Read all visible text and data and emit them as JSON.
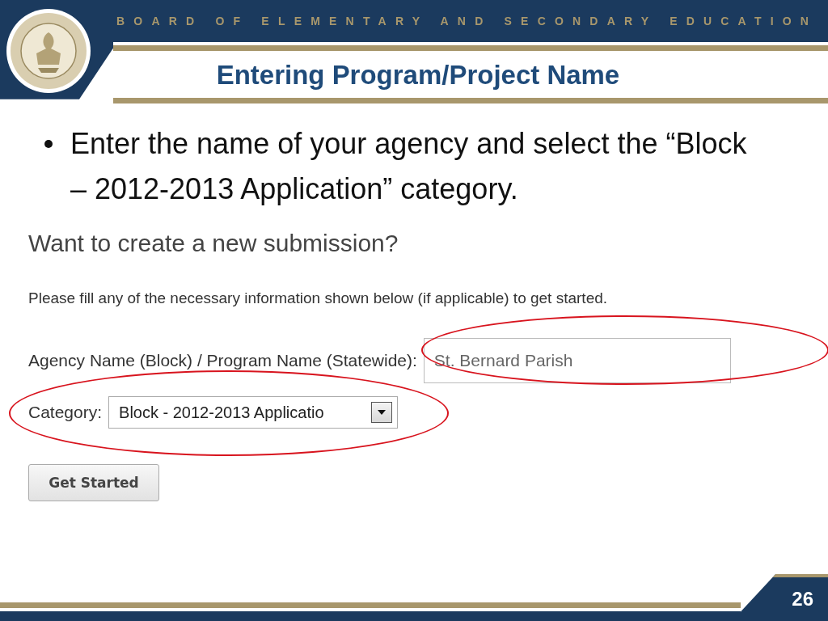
{
  "header": {
    "organization": "BOARD OF ELEMENTARY AND SECONDARY EDUCATION",
    "title": "Entering Program/Project Name"
  },
  "bullets": [
    "Enter the name of your agency and select the “Block – 2012-2013 Application” category."
  ],
  "form": {
    "heading": "Want to create a new submission?",
    "instructions": "Please fill any of the necessary information shown below (if applicable) to get started.",
    "fields": [
      {
        "kind": "text",
        "label": "Agency Name (Block) / Program Name (Statewide):",
        "value": "St. Bernard Parish",
        "highlighted": true
      },
      {
        "kind": "select",
        "label": "Category:",
        "value": "Block - 2012-2013 Applicatio",
        "highlighted": true
      }
    ],
    "button": "Get Started"
  },
  "page_number": "26"
}
